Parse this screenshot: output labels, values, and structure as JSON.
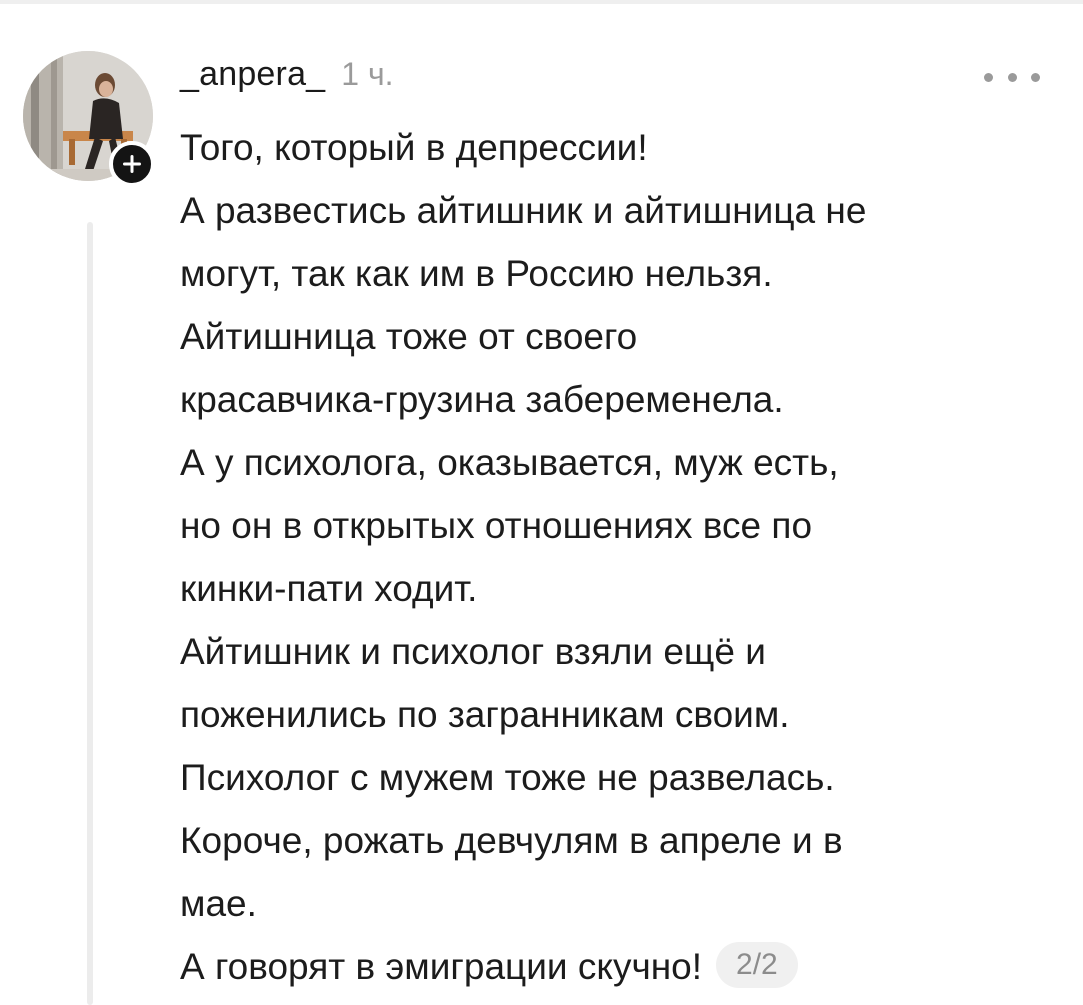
{
  "comment": {
    "username": "_anpera_",
    "timestamp": "1 ч.",
    "follow_icon": "plus-icon",
    "more_icon": "more-dots-icon",
    "lines": [
      "Того, который в депрессии!",
      "А развестись айтишник и айтишница не",
      "могут, так как им в Россию нельзя.",
      "Айтишница тоже от своего",
      "красавчика-грузина забеременела.",
      "А у психолога, оказывается, муж есть,",
      "но он в открытых отношениях все по",
      "кинки-пати ходит.",
      "Айтишник и психолог взяли ещё и",
      "поженились по загранникам своим.",
      "Психолог с мужем тоже не развелась.",
      "Короче, рожать девчулям в апреле и в",
      "мае.",
      "А говорят в эмиграции скучно!"
    ],
    "page_indicator": "2/2"
  },
  "colors": {
    "text": "#1c1c1c",
    "muted": "#9a9a9a",
    "badge_bg": "#f0f0f0",
    "follow_bg": "#141414"
  }
}
